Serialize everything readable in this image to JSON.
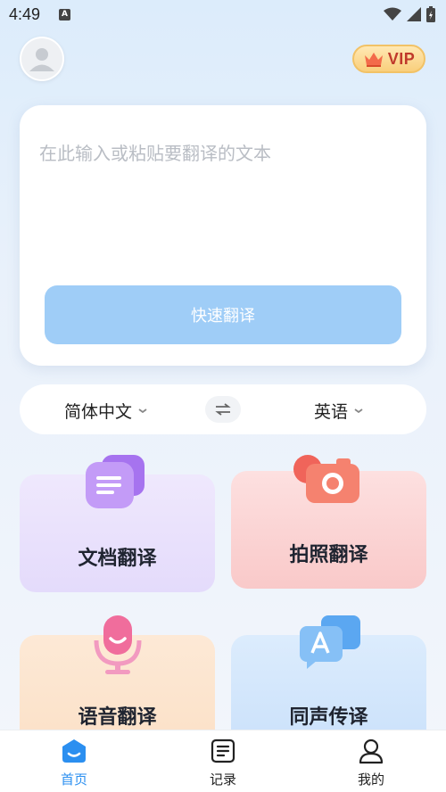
{
  "status_bar": {
    "time": "4:49",
    "notif_letter": "A"
  },
  "header": {
    "vip_label": "VIP"
  },
  "input": {
    "placeholder": "在此输入或粘贴要翻译的文本",
    "translate_label": "快速翻译"
  },
  "languages": {
    "source": "简体中文",
    "target": "英语"
  },
  "features": [
    {
      "label": "文档翻译",
      "icon": "document-icon"
    },
    {
      "label": "拍照翻译",
      "icon": "camera-icon"
    },
    {
      "label": "语音翻译",
      "icon": "microphone-icon"
    },
    {
      "label": "同声传译",
      "icon": "chat-translate-icon"
    }
  ],
  "tabs": [
    {
      "label": "首页",
      "icon": "home-icon",
      "active": true
    },
    {
      "label": "记录",
      "icon": "records-icon",
      "active": false
    },
    {
      "label": "我的",
      "icon": "profile-icon",
      "active": false
    }
  ],
  "colors": {
    "accent": "#2b8ff0",
    "button": "#9fcdf7",
    "vip_text": "#c0392b"
  }
}
